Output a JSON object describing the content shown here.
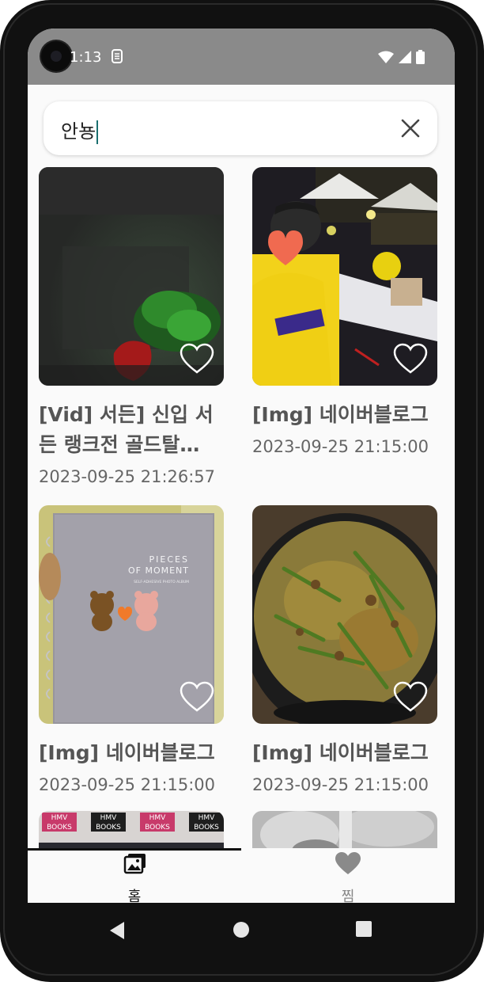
{
  "status_bar": {
    "time": "1:13"
  },
  "search": {
    "query": "안뇽"
  },
  "cards": [
    {
      "title": "[Vid] 서든] 신입 서든 랭크전 골드탈…",
      "date": "2023-09-25 21:26:57",
      "image": "dark-green-video-frame"
    },
    {
      "title": "[Img] 네이버블로그",
      "date": "2023-09-25 21:15:00",
      "image": "person-yellow-shirt-festival"
    },
    {
      "title": "[Img] 네이버블로그",
      "date": "2023-09-25 21:15:00",
      "image": "pieces-of-moment-photo-album"
    },
    {
      "title": "[Img] 네이버블로그",
      "date": "2023-09-25 21:15:00",
      "image": "green-onion-pancake"
    },
    {
      "title": "",
      "date": "",
      "image": "hmv-books-shelf"
    },
    {
      "title": "",
      "date": "",
      "image": "grey-crystal-blur"
    }
  ],
  "album_text": {
    "line1": "PIECES",
    "line2": "OF MOMENT",
    "line3": "SELF-ADHESIVE PHOTO ALBUM"
  },
  "shelf_text": {
    "brand1": "HMV",
    "brand2": "BOOKS"
  },
  "bottom_nav": {
    "items": [
      {
        "label": "홈",
        "icon": "gallery-icon",
        "selected": true
      },
      {
        "label": "찜",
        "icon": "heart-icon",
        "selected": false
      }
    ]
  },
  "colors": {
    "accent": "#1a6f6f",
    "nav_selected": "#111111",
    "nav_unselected": "#888888",
    "status_bar": "#8a8a8a"
  }
}
